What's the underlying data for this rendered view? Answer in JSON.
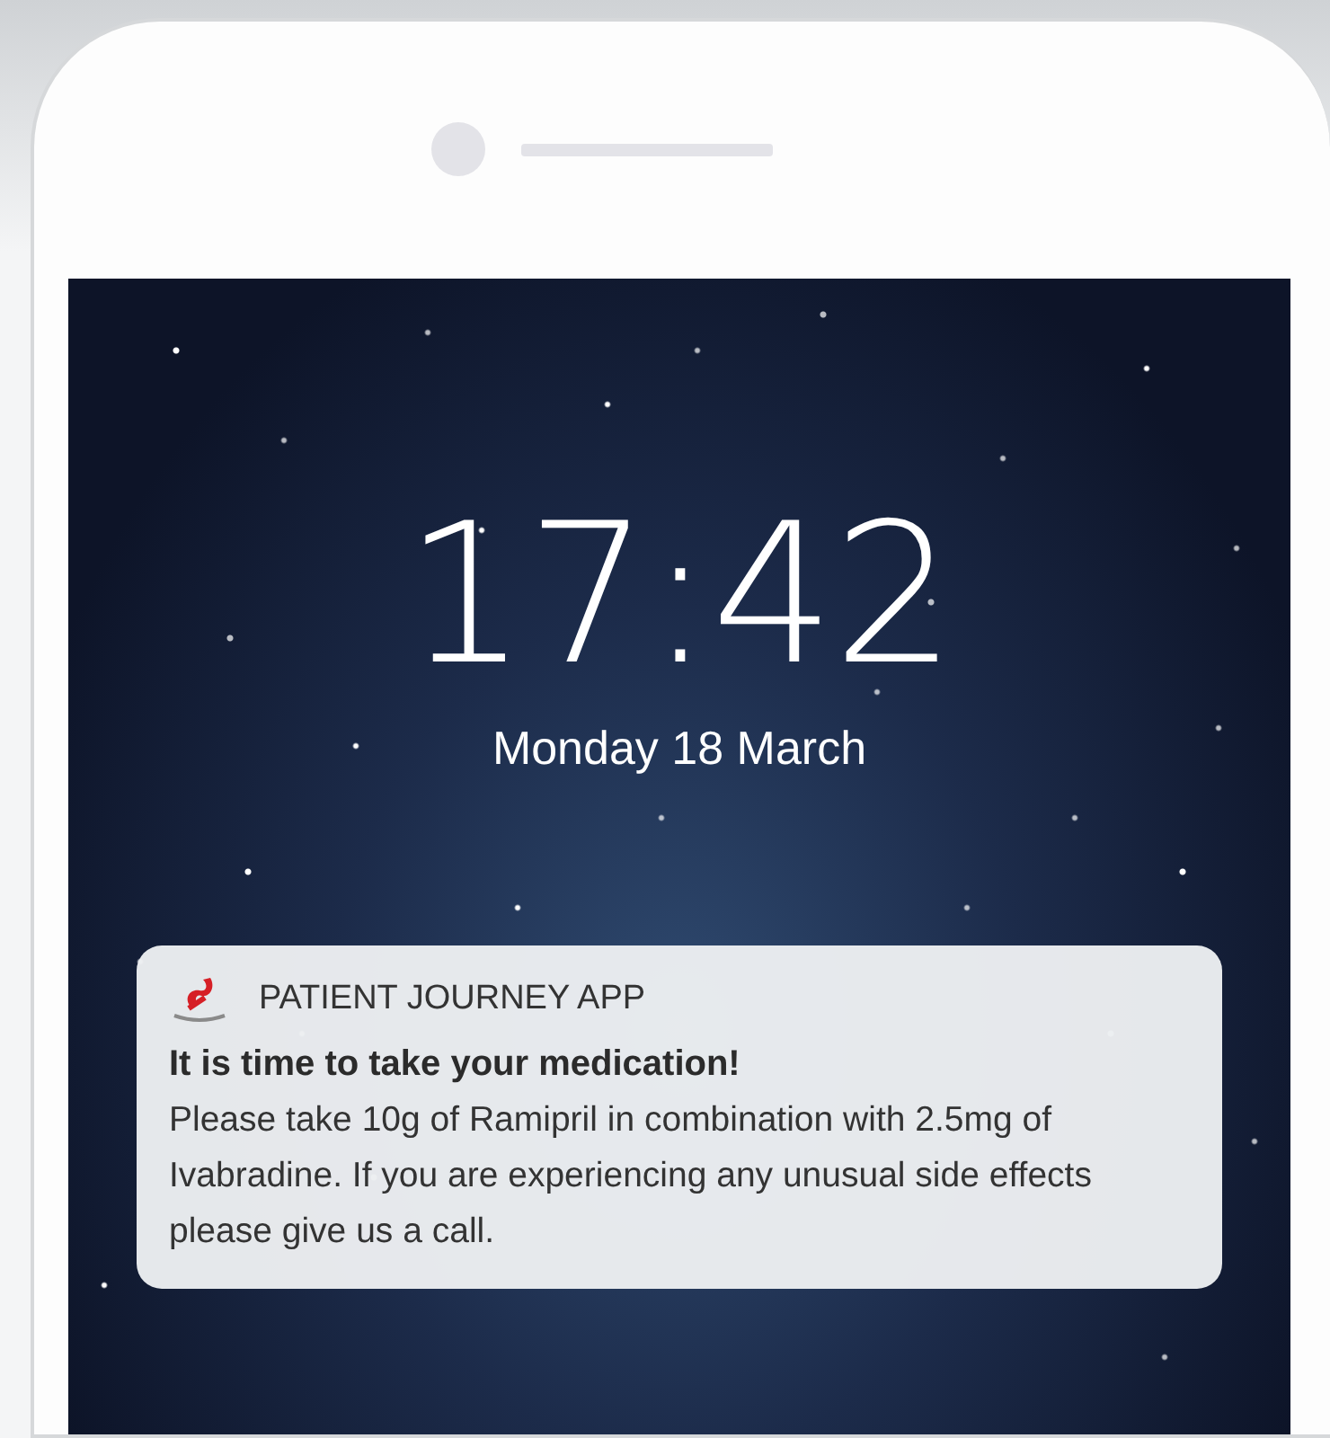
{
  "lock_screen": {
    "time": "17:42",
    "date": "Monday 18 March"
  },
  "notification": {
    "app_name": "PATIENT JOURNEY APP",
    "title": "It is time to take your medication!",
    "body": "Please take 10g of Ramipril in combination with 2.5mg of Ivabradine. If you are experiencing any unusual side effects please give us a call."
  }
}
